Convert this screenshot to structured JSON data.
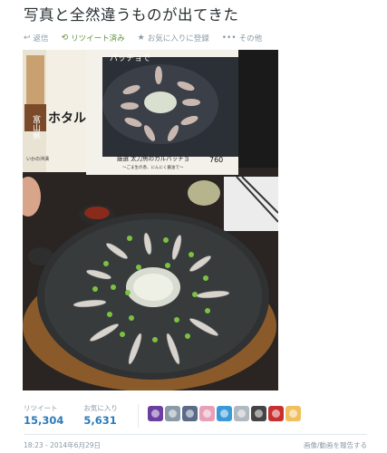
{
  "tweet": {
    "text": "写真と全然違うものが出てきた"
  },
  "actions": {
    "reply": "返信",
    "retweet": "リツイート済み",
    "favorite": "お気に入りに登録",
    "more": "その他"
  },
  "photo": {
    "menu_big_text": "ホタルいか",
    "menu_sign_text": "富山県",
    "menu_tag": "パッチョで",
    "menu_caption": "厳選 太刀魚のカルパッチョ",
    "menu_sub": "〜ごま生の香、にんにく醤油で〜",
    "menu_price": "760",
    "menu_side": "いかの沖漬"
  },
  "stats": {
    "retweets_label": "リツイート",
    "retweets_value": "15,304",
    "favorites_label": "お気に入り",
    "favorites_value": "5,631"
  },
  "avatars": [
    {
      "color": "#6a3fa0",
      "icon": "avatar-purple"
    },
    {
      "color": "#8a9aa8",
      "icon": "avatar-grey"
    },
    {
      "color": "#5a6a88",
      "icon": "avatar-blue"
    },
    {
      "color": "#e8a0b8",
      "icon": "avatar-pink"
    },
    {
      "color": "#3a9ad8",
      "icon": "avatar-sky"
    },
    {
      "color": "#b0b8c0",
      "icon": "avatar-silver"
    },
    {
      "color": "#444444",
      "icon": "avatar-dark"
    },
    {
      "color": "#c83030",
      "icon": "avatar-red"
    },
    {
      "color": "#f0c060",
      "icon": "avatar-yellow"
    }
  ],
  "meta": {
    "timestamp": "18:23 - 2014年6月29日",
    "report": "画像/動画を報告する"
  }
}
